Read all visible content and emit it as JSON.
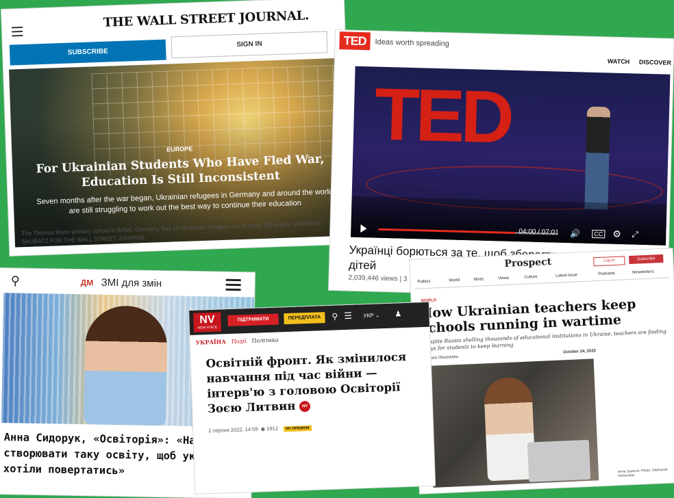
{
  "wsj": {
    "logo": "THE WALL STREET JOURNAL.",
    "subscribe": "SUBSCRIBE",
    "sign_in": "SIGN IN",
    "kicker": "EUROPE",
    "headline": "For Ukrainian Students Who Have Fled War, Education Is Still Inconsistent",
    "dek": "Seven months after the war began, Ukrainian refugees in Germany and around the world are still struggling to work out the best way to continue their education",
    "caption": "The Thomas Mann primary school in Erfurt, Germany, has 14 Ukrainian refugees out of some 300 pupils. MARZENA SKUBATZ FOR THE WALL STREET JOURNAL"
  },
  "ted": {
    "logo": "TED",
    "tagline": "Ideas worth spreading",
    "nav_watch": "WATCH",
    "nav_discover": "DISCOVER",
    "video_text": "TED",
    "time": "04:00 / 07:01",
    "cc": "CC",
    "title_line1": "Українці борються за те, щоб зберегти нав...",
    "title_line2": "дітей",
    "meta": "2,039,446 views | 3"
  },
  "prospect": {
    "logo": "Prospect",
    "login": "Log in",
    "subscribe": "Subscribe",
    "nav": [
      "Politics",
      "World",
      "Ideas",
      "Views",
      "Culture",
      "Latest issue",
      "Podcasts",
      "Newsletters"
    ],
    "kicker": "WORLD",
    "headline": "How Ukrainian teachers keep schools running in wartime",
    "dek": "Despite Russia shelling thousands of educational institutions in Ukraine, teachers are finding ways for students to keep learning",
    "byline": "by Lara Olszewska",
    "date": "October 24, 2022",
    "photo_caption": "Anna Sydoruk. Photo: Oleksandr Verbovskyi"
  },
  "dm": {
    "brand": "ДМ",
    "tagline": "ЗМІ для змін",
    "headline": "Анна Сидорук, «Освіторія»: «Нам треба створювати таку освіту, щоб українці хотіли повертатись»"
  },
  "nv": {
    "logo": "NV",
    "logo_sub": "NEW VOICE",
    "support": "ПІДТРИМАТИ",
    "subscribe": "ПЕРЕДПЛАТА",
    "lang": "УКР",
    "crumb1": "УКРАЇНА",
    "crumb2": "Події",
    "crumb3": "Політика",
    "headline": "Освітній фронт. Як змінилося навчання під час війни — інтерв'ю з головою Освіторії Зоєю Литвин",
    "badge": "NV",
    "date": "2 серпня 2022, 14:59",
    "views": "1912",
    "premium": "NV ПРЕМІУМ"
  },
  "colors": {
    "background": "#2fa84f",
    "wsj_blue": "#0274b6",
    "ted_red": "#e62b1e",
    "nv_red": "#c7161d",
    "nv_yellow": "#f2c01c",
    "prospect_red": "#c8343a",
    "dm_red": "#c4322b"
  }
}
